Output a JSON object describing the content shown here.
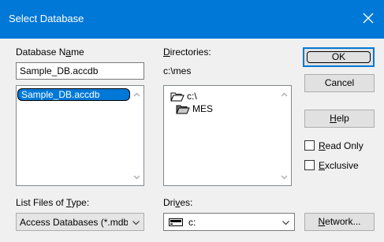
{
  "window": {
    "title": "Select Database"
  },
  "database_name": {
    "label_pre": "Database N",
    "label_accel": "a",
    "label_post": "me",
    "value": "Sample_DB.accdb",
    "files": [
      "Sample_DB.accdb"
    ]
  },
  "directories": {
    "label_accel": "D",
    "label_post": "irectories:",
    "current_path": "c:\\mes",
    "tree": [
      {
        "name": "c:\\",
        "icon": "open-folder-icon"
      },
      {
        "name": "MES",
        "icon": "open-folder-icon"
      }
    ]
  },
  "buttons": {
    "ok": "OK",
    "cancel": "Cancel",
    "help_accel": "H",
    "help_post": "elp",
    "network_accel": "N",
    "network_post": "etwork..."
  },
  "options": {
    "read_only_accel": "R",
    "read_only_post": "ead Only",
    "exclusive_accel": "E",
    "exclusive_post": "xclusive"
  },
  "file_type": {
    "label_pre": "List Files of ",
    "label_accel": "T",
    "label_post": "ype:",
    "value": "Access Databases (*.mdb"
  },
  "drives": {
    "label_pre": "Dri",
    "label_accel": "v",
    "label_post": "es:",
    "value": "c:"
  }
}
